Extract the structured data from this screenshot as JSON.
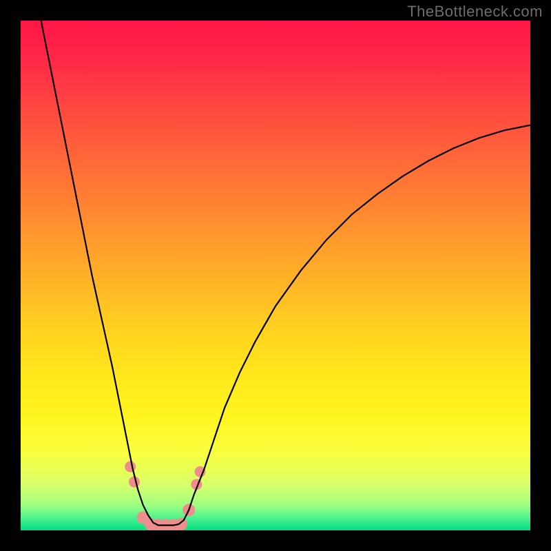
{
  "watermark": "TheBottleneck.com",
  "chart_data": {
    "type": "line",
    "title": "",
    "xlabel": "",
    "ylabel": "",
    "xlim": [
      0,
      100
    ],
    "ylim": [
      0,
      100
    ],
    "series": [
      {
        "name": "bottleneck-curve",
        "x": [
          4,
          6,
          8,
          10,
          12,
          14,
          16,
          18,
          20,
          21,
          22,
          23,
          24,
          25,
          26,
          27,
          28,
          29,
          30,
          31,
          32,
          33,
          34,
          36,
          38,
          40,
          43,
          46,
          50,
          55,
          60,
          65,
          70,
          75,
          80,
          85,
          90,
          95,
          100
        ],
        "values": [
          100,
          90,
          80,
          70,
          60,
          50,
          41,
          32,
          22,
          17,
          12,
          8,
          5,
          3,
          1.5,
          1,
          1,
          1,
          1,
          1.2,
          2,
          4,
          7,
          12,
          18,
          24,
          31,
          37,
          44,
          51,
          57,
          62,
          66,
          69.5,
          72.5,
          75,
          77,
          78.5,
          79.5
        ]
      }
    ],
    "markers": {
      "name": "highlighted-points",
      "color": "#ef8d8d",
      "points": [
        {
          "x": 21.5,
          "y": 12.5,
          "r": 8
        },
        {
          "x": 22.3,
          "y": 9.5,
          "r": 8
        },
        {
          "x": 24.0,
          "y": 2.5,
          "r": 9
        },
        {
          "x": 25.5,
          "y": 1.2,
          "r": 9
        },
        {
          "x": 27.0,
          "y": 1.0,
          "r": 9
        },
        {
          "x": 28.5,
          "y": 1.0,
          "r": 9
        },
        {
          "x": 30.0,
          "y": 1.0,
          "r": 9
        },
        {
          "x": 31.5,
          "y": 1.2,
          "r": 9
        },
        {
          "x": 33.0,
          "y": 4.0,
          "r": 9
        },
        {
          "x": 34.5,
          "y": 9.0,
          "r": 8
        },
        {
          "x": 35.2,
          "y": 11.5,
          "r": 8
        }
      ]
    },
    "background_gradient": {
      "top": "#ff1648",
      "mid": "#ffe81a",
      "bottom": "#00e080"
    }
  }
}
